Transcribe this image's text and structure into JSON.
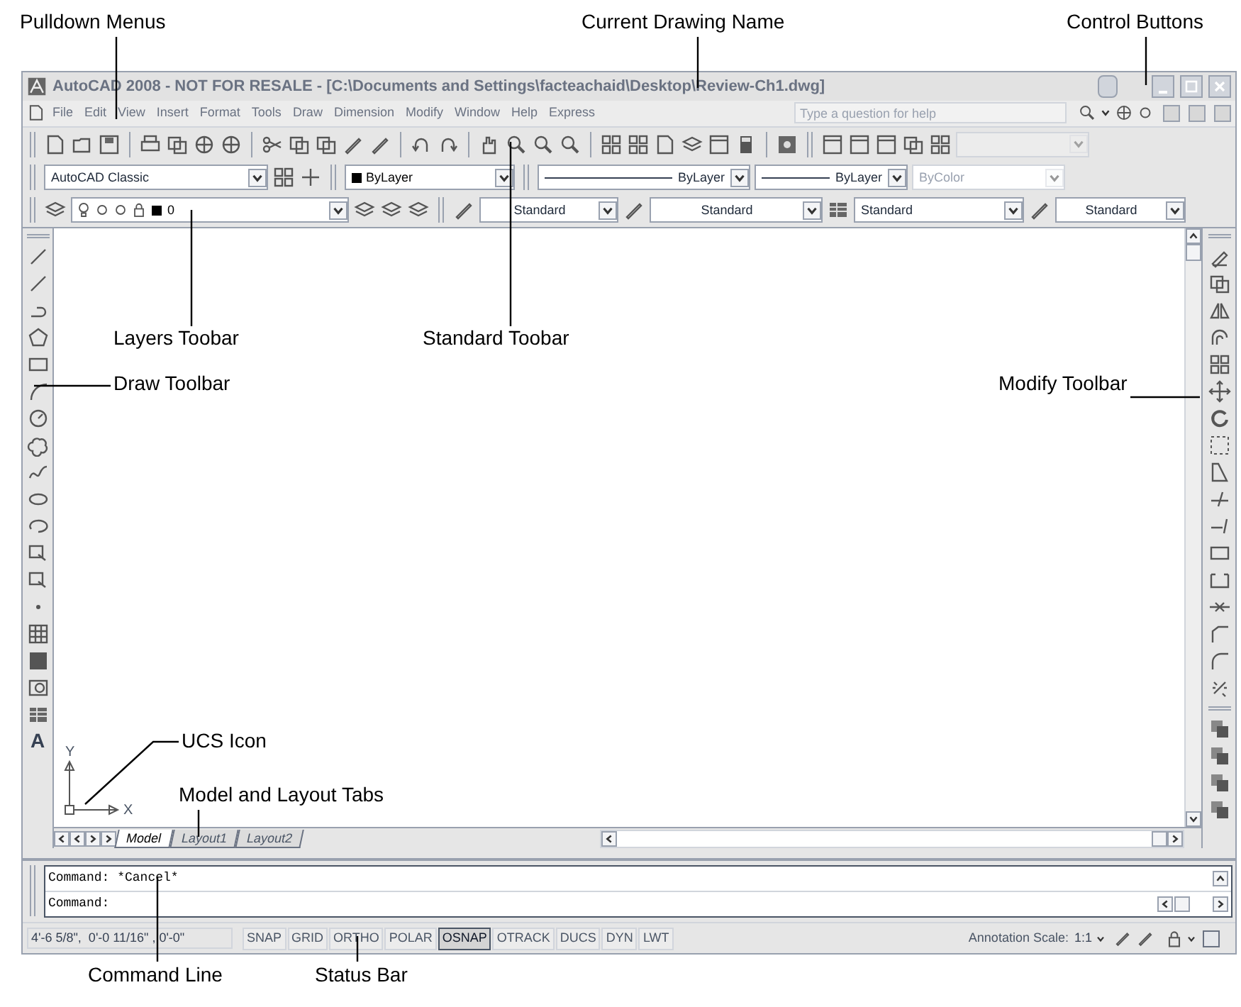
{
  "callouts": [
    {
      "label": "Pulldown Menus"
    },
    {
      "label": "Current Drawing Name"
    },
    {
      "label": "Control Buttons"
    },
    {
      "label": "Layers Toobar"
    },
    {
      "label": "Standard Toobar"
    },
    {
      "label": "Draw Toolbar"
    },
    {
      "label": "Modify Toolbar"
    },
    {
      "label": "UCS Icon"
    },
    {
      "label": "Model and Layout Tabs"
    },
    {
      "label": "Command Line"
    },
    {
      "label": "Status Bar"
    }
  ],
  "window": {
    "title": "AutoCAD 2008 - NOT FOR RESALE - [C:\\Documents and Settings\\facteachaid\\Desktop\\Review-Ch1.dwg]"
  },
  "menu_bar": {
    "items": [
      "File",
      "Edit",
      "View",
      "Insert",
      "Format",
      "Tools",
      "Draw",
      "Dimension",
      "Modify",
      "Window",
      "Help",
      "Express"
    ],
    "help_search": {
      "placeholder": "Type a question for help"
    }
  },
  "properties_toolbar": {
    "workspace": "AutoCAD Classic",
    "color_control": "ByLayer",
    "linetype": "ByLayer",
    "lineweight": "ByLayer",
    "plot_style": {
      "value": "ByColor",
      "disabled": true
    }
  },
  "layers_toolbar": {
    "layer": "0"
  },
  "styles_toolbar": {
    "text_style": "Standard",
    "dimension_style": "Standard",
    "table_style": "Standard",
    "multileader_style": "Standard"
  },
  "draw_toolbar": {
    "text_tool": "A"
  },
  "ucs_icon": {
    "y_label": "Y",
    "x_label": "X"
  },
  "layout_tabs": [
    {
      "label": "Model",
      "selected": true
    },
    {
      "label": "Layout1",
      "selected": false
    },
    {
      "label": "Layout2",
      "selected": false
    }
  ],
  "command_line": {
    "lines": [
      "Command: *Cancel*",
      "Command:"
    ]
  },
  "status_bar": {
    "coordinates": "4'-6 5/8\",  0'-0 11/16\" , 0'-0\"",
    "toggles": [
      {
        "label": "SNAP",
        "selected": false
      },
      {
        "label": "GRID",
        "selected": false
      },
      {
        "label": "ORTHO",
        "selected": false
      },
      {
        "label": "POLAR",
        "selected": false
      },
      {
        "label": "OSNAP",
        "selected": true
      },
      {
        "label": "OTRACK",
        "selected": false
      },
      {
        "label": "DUCS",
        "selected": false
      },
      {
        "label": "DYN",
        "selected": false
      },
      {
        "label": "LWT",
        "selected": false
      }
    ],
    "annotation_scale_label": "Annotation Scale:",
    "annotation_scale": "1:1"
  }
}
